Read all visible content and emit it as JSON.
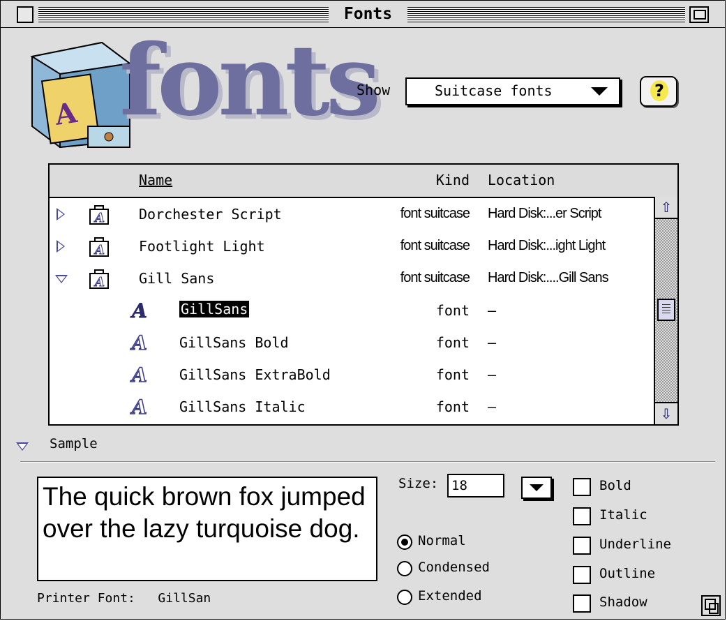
{
  "window": {
    "title": "Fonts"
  },
  "header": {
    "logo_text": "fonts",
    "show_label": "Show",
    "show_value": "Suitcase fonts",
    "help_icon": "question-mark-icon"
  },
  "list": {
    "columns": {
      "name": "Name",
      "kind": "Kind",
      "location": "Location"
    },
    "rows": [
      {
        "name": "Dorchester Script",
        "kind": "font suitcase",
        "location": "Hard Disk:...er Script",
        "expander": "closed",
        "icon": "suitcase-icon"
      },
      {
        "name": "Footlight Light",
        "kind": "font suitcase",
        "location": "Hard Disk:...ight Light",
        "expander": "closed",
        "icon": "suitcase-icon"
      },
      {
        "name": "Gill Sans",
        "kind": "font suitcase",
        "location": "Hard Disk:....Gill Sans",
        "expander": "open",
        "icon": "suitcase-icon"
      },
      {
        "name": "GillSans",
        "kind": "font",
        "location": "–",
        "selected": true,
        "icon": "font-icon"
      },
      {
        "name": "GillSans Bold",
        "kind": "font",
        "location": "–",
        "icon": "font-icon"
      },
      {
        "name": "GillSans ExtraBold",
        "kind": "font",
        "location": "–",
        "icon": "font-icon"
      },
      {
        "name": "GillSans Italic",
        "kind": "font",
        "location": "–",
        "icon": "font-icon"
      }
    ]
  },
  "sample": {
    "label": "Sample",
    "text": "The quick brown fox jumped over the lazy turquoise dog.",
    "printer_font_label": "Printer Font:",
    "printer_font_value": "GillSan",
    "size_label": "Size:",
    "size_value": "18",
    "width_options": [
      {
        "label": "Normal",
        "selected": true
      },
      {
        "label": "Condensed",
        "selected": false
      },
      {
        "label": "Extended",
        "selected": false
      }
    ],
    "styles": [
      {
        "label": "Bold",
        "checked": false
      },
      {
        "label": "Italic",
        "checked": false
      },
      {
        "label": "Underline",
        "checked": false
      },
      {
        "label": "Outline",
        "checked": false
      },
      {
        "label": "Shadow",
        "checked": false
      }
    ]
  },
  "colors": {
    "accent": "#6f6f9f",
    "expander": "#4a4a9a",
    "selection": "#000000",
    "window_bg": "#dedede"
  }
}
